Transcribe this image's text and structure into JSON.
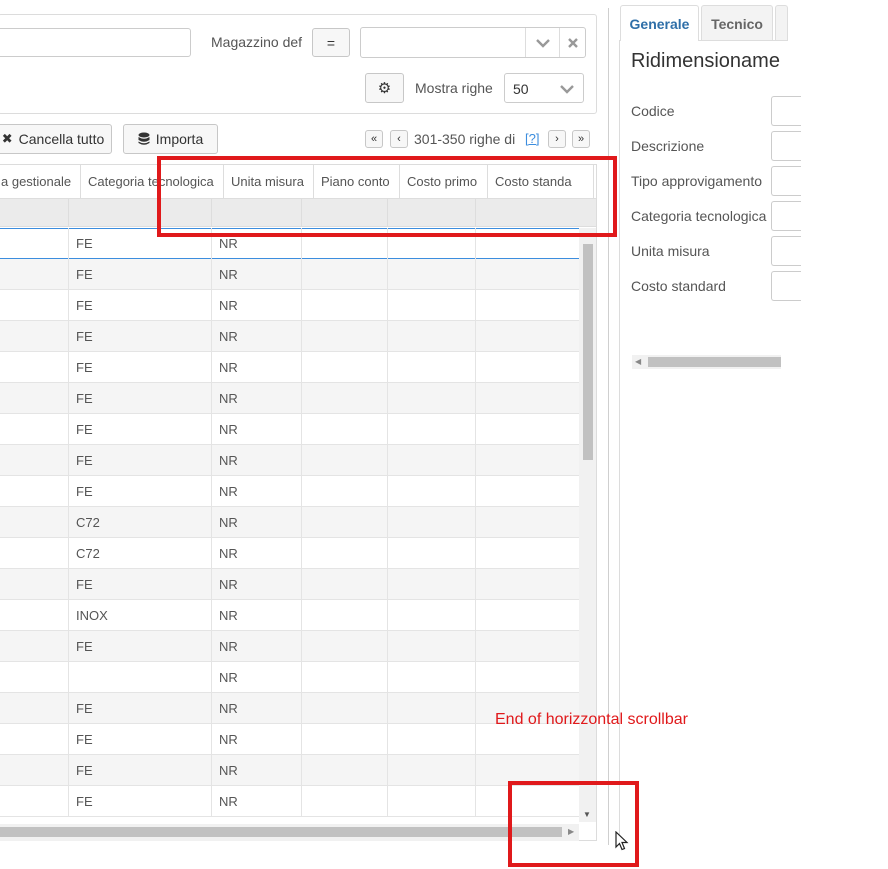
{
  "filters": {
    "magazzino_label": "Magazzino def",
    "operator_label": "=",
    "magazzino_value": "",
    "mostra_righe_label": "Mostra righe",
    "mostra_righe_value": "50"
  },
  "toolbar": {
    "clear_all_label": "Cancella tutto",
    "import_label": "Importa",
    "pager_text": "301-350 righe di",
    "pager_help": "[?]"
  },
  "grid": {
    "columns": [
      "a gestionale",
      "Categoria tecnologica",
      "Unita misura",
      "Piano conto",
      "Costo primo",
      "Costo standa"
    ],
    "rows": [
      {
        "cat": "FE",
        "um": "NR"
      },
      {
        "cat": "FE",
        "um": "NR"
      },
      {
        "cat": "FE",
        "um": "NR"
      },
      {
        "cat": "FE",
        "um": "NR"
      },
      {
        "cat": "FE",
        "um": "NR"
      },
      {
        "cat": "FE",
        "um": "NR"
      },
      {
        "cat": "FE",
        "um": "NR"
      },
      {
        "cat": "FE",
        "um": "NR"
      },
      {
        "cat": "FE",
        "um": "NR"
      },
      {
        "cat": "C72",
        "um": "NR"
      },
      {
        "cat": "C72",
        "um": "NR"
      },
      {
        "cat": "FE",
        "um": "NR"
      },
      {
        "cat": "INOX",
        "um": "NR"
      },
      {
        "cat": "FE",
        "um": "NR"
      },
      {
        "cat": "",
        "um": "NR"
      },
      {
        "cat": "FE",
        "um": "NR"
      },
      {
        "cat": "FE",
        "um": "NR"
      },
      {
        "cat": "FE",
        "um": "NR"
      },
      {
        "cat": "FE",
        "um": "NR"
      }
    ]
  },
  "detail": {
    "tabs": [
      "Generale",
      "Tecnico"
    ],
    "title": "Ridimensionamer",
    "fields": [
      "Codice",
      "Descrizione",
      "Tipo approvigamento",
      "Categoria tecnologica",
      "Unita misura",
      "Costo standard"
    ]
  },
  "annotation": {
    "text": "End of horizzontal scrollbar",
    "color": "#e0191b"
  }
}
